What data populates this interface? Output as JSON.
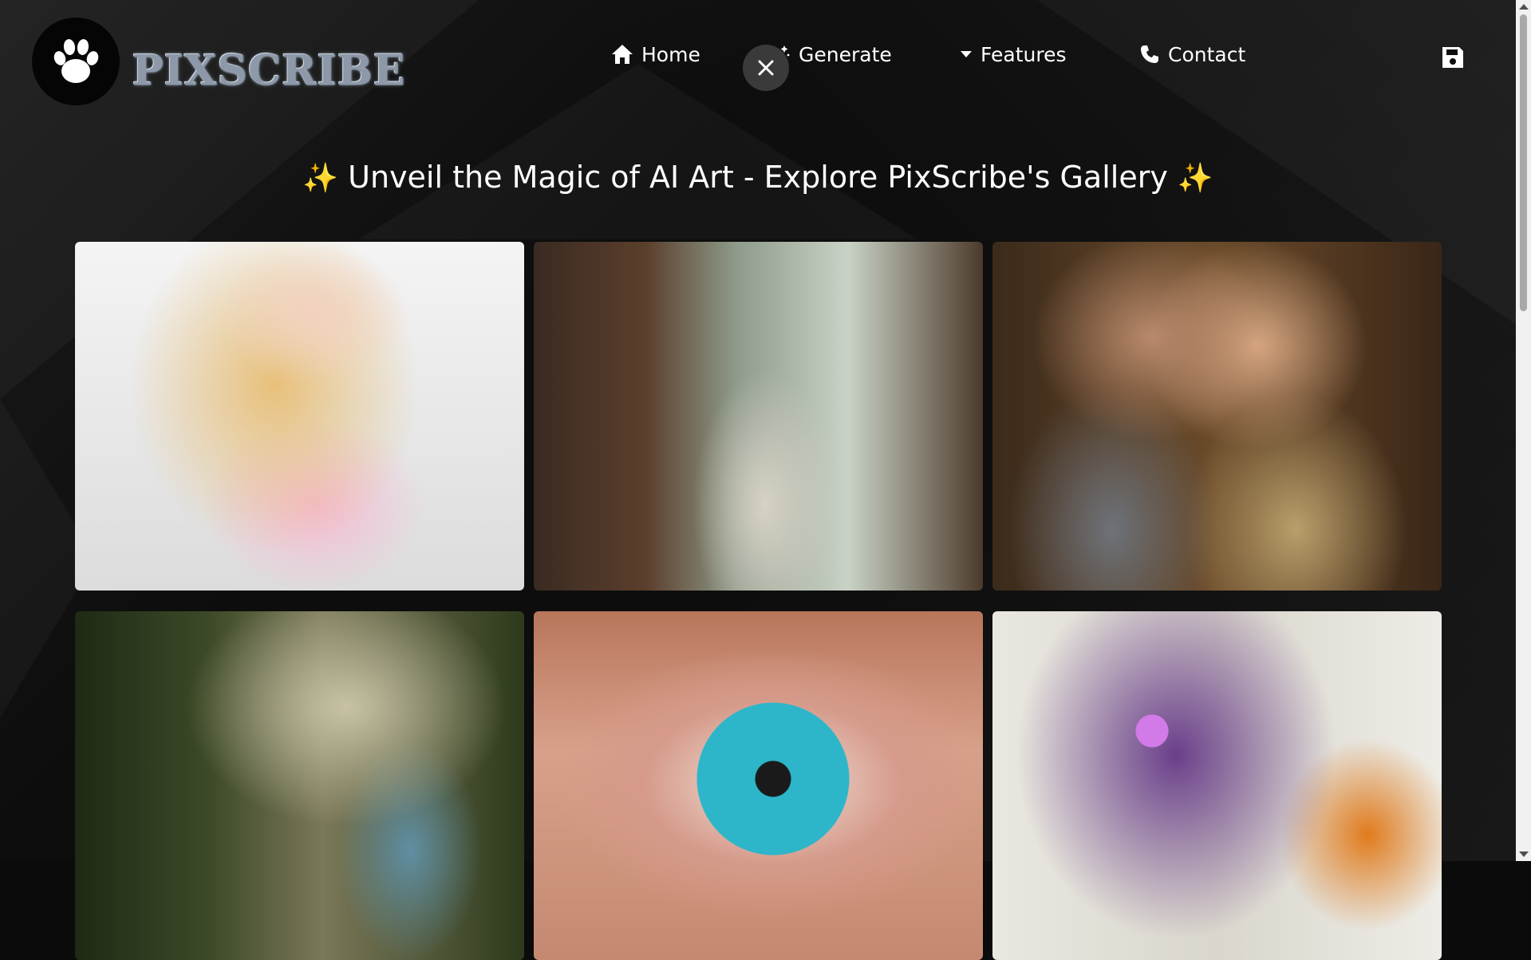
{
  "header": {
    "brand": "PIXSCRIBE",
    "logo_icon": "paw-icon",
    "nav": [
      {
        "label": "Home",
        "icon": "home-icon"
      },
      {
        "label": "Generate",
        "icon": "magic-wand-icon"
      },
      {
        "label": "Features",
        "icon": "caret-down-icon"
      },
      {
        "label": "Contact",
        "icon": "phone-icon"
      }
    ],
    "close_icon": "close-icon",
    "save_icon": "save-icon"
  },
  "main": {
    "title_left_icon": "✨",
    "title": "Unveil the Magic of AI Art - Explore PixScribe's Gallery",
    "title_right_icon": "✨",
    "gallery": [
      {
        "name": "gallery-image-1"
      },
      {
        "name": "gallery-image-2"
      },
      {
        "name": "gallery-image-3"
      },
      {
        "name": "gallery-image-4"
      },
      {
        "name": "gallery-image-5"
      },
      {
        "name": "gallery-image-6"
      }
    ]
  },
  "colors": {
    "background": "#0d0d0d",
    "text": "#ffffff",
    "sparkle": "#ffd23f",
    "close_button_bg": "#3a3a3a"
  }
}
